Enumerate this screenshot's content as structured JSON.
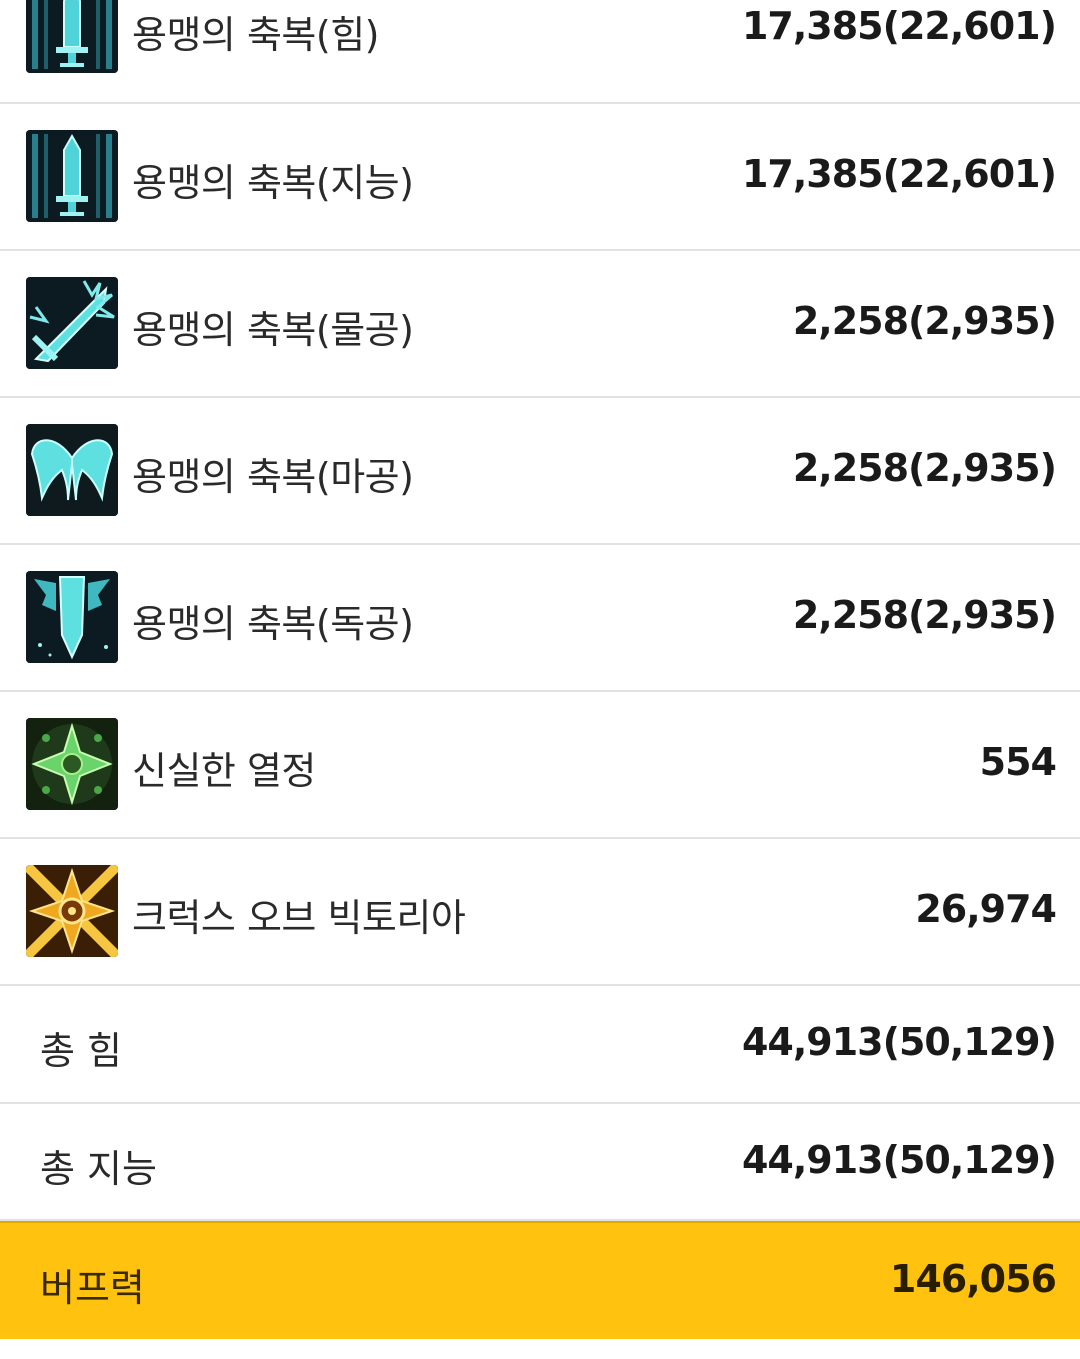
{
  "buffs": [
    {
      "name": "용맹의 축복(힘)",
      "value": "17,385(22,601)",
      "icon": "sword-icon",
      "icon_color": "#4fd3d8"
    },
    {
      "name": "용맹의 축복(지능)",
      "value": "17,385(22,601)",
      "icon": "sword-icon",
      "icon_color": "#4fd3d8"
    },
    {
      "name": "용맹의 축복(물공)",
      "value": "2,258(2,935)",
      "icon": "slash-sword-icon",
      "icon_color": "#5fe0e0"
    },
    {
      "name": "용맹의 축복(마공)",
      "value": "2,258(2,935)",
      "icon": "wings-icon",
      "icon_color": "#5fe0e0"
    },
    {
      "name": "용맹의 축복(독공)",
      "value": "2,258(2,935)",
      "icon": "winged-sword-icon",
      "icon_color": "#5fe0e0"
    },
    {
      "name": "신실한 열정",
      "value": "554",
      "icon": "green-cross-icon",
      "icon_color": "#6bd36b"
    },
    {
      "name": "크럭스 오브 빅토리아",
      "value": "26,974",
      "icon": "golden-emblem-icon",
      "icon_color": "#f0a820"
    }
  ],
  "totals": [
    {
      "label": "총 힘",
      "value": "44,913(50,129)"
    },
    {
      "label": "총 지능",
      "value": "44,913(50,129)"
    }
  ],
  "buff_power": {
    "label": "버프력",
    "value": "146,056"
  },
  "colors": {
    "highlight": "#ffc20e",
    "divider": "#e2e2e2"
  }
}
